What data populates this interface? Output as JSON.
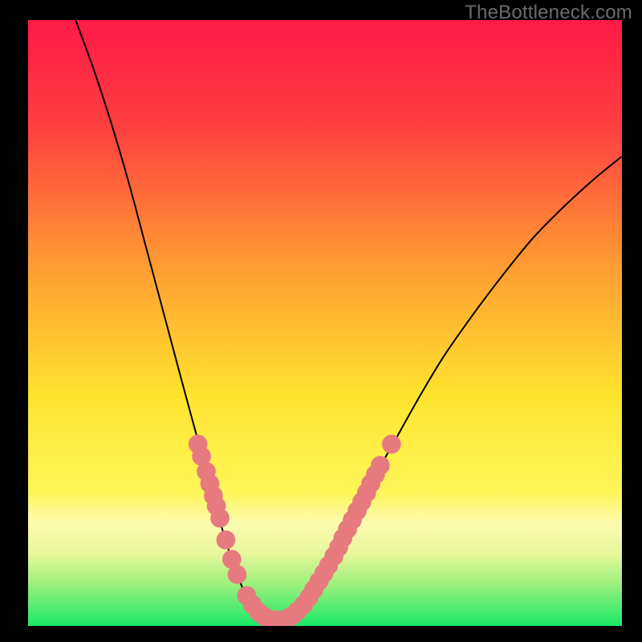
{
  "watermark": "TheBottleneck.com",
  "chart_data": {
    "type": "line",
    "title": "",
    "xlabel": "",
    "ylabel": "",
    "xlim": [
      0,
      100
    ],
    "ylim": [
      0,
      100
    ],
    "gradient_stops": [
      {
        "offset": 0,
        "color": "#ff1a46"
      },
      {
        "offset": 18,
        "color": "#ff4040"
      },
      {
        "offset": 40,
        "color": "#ff9a33"
      },
      {
        "offset": 62,
        "color": "#ffe42e"
      },
      {
        "offset": 78,
        "color": "#fff65a"
      },
      {
        "offset": 83,
        "color": "#fdfbb0"
      },
      {
        "offset": 88,
        "color": "#e8f79a"
      },
      {
        "offset": 93,
        "color": "#9ef07e"
      },
      {
        "offset": 100,
        "color": "#19e867"
      }
    ],
    "curve": {
      "comment": "V-shaped bottleneck curve; x is relative position 0..100, y is percent (100 top, 0 bottom)",
      "points": [
        {
          "x": 8.0,
          "y": 100.0
        },
        {
          "x": 11.0,
          "y": 92.0
        },
        {
          "x": 14.0,
          "y": 83.0
        },
        {
          "x": 17.0,
          "y": 73.0
        },
        {
          "x": 20.0,
          "y": 62.0
        },
        {
          "x": 23.0,
          "y": 51.0
        },
        {
          "x": 26.0,
          "y": 40.0
        },
        {
          "x": 28.5,
          "y": 31.0
        },
        {
          "x": 31.0,
          "y": 22.0
        },
        {
          "x": 33.0,
          "y": 15.0
        },
        {
          "x": 35.0,
          "y": 9.0
        },
        {
          "x": 37.0,
          "y": 4.5
        },
        {
          "x": 39.0,
          "y": 2.0
        },
        {
          "x": 41.0,
          "y": 1.0
        },
        {
          "x": 43.0,
          "y": 1.0
        },
        {
          "x": 45.0,
          "y": 2.0
        },
        {
          "x": 47.0,
          "y": 4.0
        },
        {
          "x": 49.0,
          "y": 7.0
        },
        {
          "x": 52.0,
          "y": 12.0
        },
        {
          "x": 55.0,
          "y": 18.0
        },
        {
          "x": 58.0,
          "y": 24.0
        },
        {
          "x": 62.0,
          "y": 31.0
        },
        {
          "x": 66.0,
          "y": 38.0
        },
        {
          "x": 70.0,
          "y": 44.5
        },
        {
          "x": 75.0,
          "y": 51.5
        },
        {
          "x": 80.0,
          "y": 58.0
        },
        {
          "x": 85.0,
          "y": 64.0
        },
        {
          "x": 90.0,
          "y": 69.0
        },
        {
          "x": 95.0,
          "y": 73.5
        },
        {
          "x": 100.0,
          "y": 77.5
        }
      ]
    },
    "markers": {
      "color": "#e77a7f",
      "radius": 1.6,
      "points": [
        {
          "x": 28.6,
          "y": 30.0
        },
        {
          "x": 29.2,
          "y": 28.0
        },
        {
          "x": 30.0,
          "y": 25.5
        },
        {
          "x": 30.6,
          "y": 23.5
        },
        {
          "x": 31.2,
          "y": 21.5
        },
        {
          "x": 31.7,
          "y": 19.8
        },
        {
          "x": 32.3,
          "y": 17.8
        },
        {
          "x": 33.3,
          "y": 14.2
        },
        {
          "x": 34.3,
          "y": 11.0
        },
        {
          "x": 35.2,
          "y": 8.5
        },
        {
          "x": 36.8,
          "y": 5.0
        },
        {
          "x": 37.8,
          "y": 3.5
        },
        {
          "x": 38.8,
          "y": 2.3
        },
        {
          "x": 39.7,
          "y": 1.6
        },
        {
          "x": 40.7,
          "y": 1.1
        },
        {
          "x": 41.7,
          "y": 1.0
        },
        {
          "x": 42.7,
          "y": 1.0
        },
        {
          "x": 43.6,
          "y": 1.2
        },
        {
          "x": 44.5,
          "y": 1.7
        },
        {
          "x": 45.4,
          "y": 2.5
        },
        {
          "x": 46.4,
          "y": 3.5
        },
        {
          "x": 47.3,
          "y": 4.7
        },
        {
          "x": 48.1,
          "y": 6.0
        },
        {
          "x": 49.0,
          "y": 7.4
        },
        {
          "x": 49.8,
          "y": 8.7
        },
        {
          "x": 50.6,
          "y": 10.0
        },
        {
          "x": 51.5,
          "y": 11.5
        },
        {
          "x": 52.3,
          "y": 13.0
        },
        {
          "x": 53.0,
          "y": 14.5
        },
        {
          "x": 53.8,
          "y": 16.0
        },
        {
          "x": 54.6,
          "y": 17.5
        },
        {
          "x": 55.4,
          "y": 19.0
        },
        {
          "x": 56.2,
          "y": 20.5
        },
        {
          "x": 57.0,
          "y": 22.0
        },
        {
          "x": 57.7,
          "y": 23.5
        },
        {
          "x": 58.5,
          "y": 25.0
        },
        {
          "x": 59.3,
          "y": 26.5
        },
        {
          "x": 61.2,
          "y": 30.0
        }
      ]
    }
  }
}
